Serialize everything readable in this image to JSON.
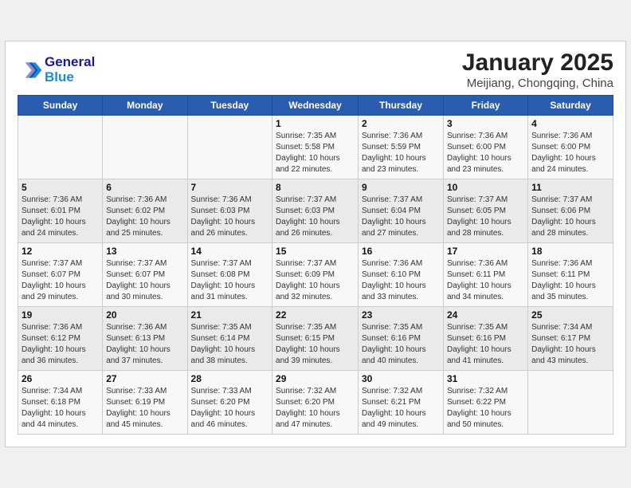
{
  "header": {
    "logo_general": "General",
    "logo_blue": "Blue",
    "month_year": "January 2025",
    "location": "Meijiang, Chongqing, China"
  },
  "weekdays": [
    "Sunday",
    "Monday",
    "Tuesday",
    "Wednesday",
    "Thursday",
    "Friday",
    "Saturday"
  ],
  "weeks": [
    [
      {
        "day": "",
        "info": ""
      },
      {
        "day": "",
        "info": ""
      },
      {
        "day": "",
        "info": ""
      },
      {
        "day": "1",
        "info": "Sunrise: 7:35 AM\nSunset: 5:58 PM\nDaylight: 10 hours\nand 22 minutes."
      },
      {
        "day": "2",
        "info": "Sunrise: 7:36 AM\nSunset: 5:59 PM\nDaylight: 10 hours\nand 23 minutes."
      },
      {
        "day": "3",
        "info": "Sunrise: 7:36 AM\nSunset: 6:00 PM\nDaylight: 10 hours\nand 23 minutes."
      },
      {
        "day": "4",
        "info": "Sunrise: 7:36 AM\nSunset: 6:00 PM\nDaylight: 10 hours\nand 24 minutes."
      }
    ],
    [
      {
        "day": "5",
        "info": "Sunrise: 7:36 AM\nSunset: 6:01 PM\nDaylight: 10 hours\nand 24 minutes."
      },
      {
        "day": "6",
        "info": "Sunrise: 7:36 AM\nSunset: 6:02 PM\nDaylight: 10 hours\nand 25 minutes."
      },
      {
        "day": "7",
        "info": "Sunrise: 7:36 AM\nSunset: 6:03 PM\nDaylight: 10 hours\nand 26 minutes."
      },
      {
        "day": "8",
        "info": "Sunrise: 7:37 AM\nSunset: 6:03 PM\nDaylight: 10 hours\nand 26 minutes."
      },
      {
        "day": "9",
        "info": "Sunrise: 7:37 AM\nSunset: 6:04 PM\nDaylight: 10 hours\nand 27 minutes."
      },
      {
        "day": "10",
        "info": "Sunrise: 7:37 AM\nSunset: 6:05 PM\nDaylight: 10 hours\nand 28 minutes."
      },
      {
        "day": "11",
        "info": "Sunrise: 7:37 AM\nSunset: 6:06 PM\nDaylight: 10 hours\nand 28 minutes."
      }
    ],
    [
      {
        "day": "12",
        "info": "Sunrise: 7:37 AM\nSunset: 6:07 PM\nDaylight: 10 hours\nand 29 minutes."
      },
      {
        "day": "13",
        "info": "Sunrise: 7:37 AM\nSunset: 6:07 PM\nDaylight: 10 hours\nand 30 minutes."
      },
      {
        "day": "14",
        "info": "Sunrise: 7:37 AM\nSunset: 6:08 PM\nDaylight: 10 hours\nand 31 minutes."
      },
      {
        "day": "15",
        "info": "Sunrise: 7:37 AM\nSunset: 6:09 PM\nDaylight: 10 hours\nand 32 minutes."
      },
      {
        "day": "16",
        "info": "Sunrise: 7:36 AM\nSunset: 6:10 PM\nDaylight: 10 hours\nand 33 minutes."
      },
      {
        "day": "17",
        "info": "Sunrise: 7:36 AM\nSunset: 6:11 PM\nDaylight: 10 hours\nand 34 minutes."
      },
      {
        "day": "18",
        "info": "Sunrise: 7:36 AM\nSunset: 6:11 PM\nDaylight: 10 hours\nand 35 minutes."
      }
    ],
    [
      {
        "day": "19",
        "info": "Sunrise: 7:36 AM\nSunset: 6:12 PM\nDaylight: 10 hours\nand 36 minutes."
      },
      {
        "day": "20",
        "info": "Sunrise: 7:36 AM\nSunset: 6:13 PM\nDaylight: 10 hours\nand 37 minutes."
      },
      {
        "day": "21",
        "info": "Sunrise: 7:35 AM\nSunset: 6:14 PM\nDaylight: 10 hours\nand 38 minutes."
      },
      {
        "day": "22",
        "info": "Sunrise: 7:35 AM\nSunset: 6:15 PM\nDaylight: 10 hours\nand 39 minutes."
      },
      {
        "day": "23",
        "info": "Sunrise: 7:35 AM\nSunset: 6:16 PM\nDaylight: 10 hours\nand 40 minutes."
      },
      {
        "day": "24",
        "info": "Sunrise: 7:35 AM\nSunset: 6:16 PM\nDaylight: 10 hours\nand 41 minutes."
      },
      {
        "day": "25",
        "info": "Sunrise: 7:34 AM\nSunset: 6:17 PM\nDaylight: 10 hours\nand 43 minutes."
      }
    ],
    [
      {
        "day": "26",
        "info": "Sunrise: 7:34 AM\nSunset: 6:18 PM\nDaylight: 10 hours\nand 44 minutes."
      },
      {
        "day": "27",
        "info": "Sunrise: 7:33 AM\nSunset: 6:19 PM\nDaylight: 10 hours\nand 45 minutes."
      },
      {
        "day": "28",
        "info": "Sunrise: 7:33 AM\nSunset: 6:20 PM\nDaylight: 10 hours\nand 46 minutes."
      },
      {
        "day": "29",
        "info": "Sunrise: 7:32 AM\nSunset: 6:20 PM\nDaylight: 10 hours\nand 47 minutes."
      },
      {
        "day": "30",
        "info": "Sunrise: 7:32 AM\nSunset: 6:21 PM\nDaylight: 10 hours\nand 49 minutes."
      },
      {
        "day": "31",
        "info": "Sunrise: 7:32 AM\nSunset: 6:22 PM\nDaylight: 10 hours\nand 50 minutes."
      },
      {
        "day": "",
        "info": ""
      }
    ]
  ]
}
